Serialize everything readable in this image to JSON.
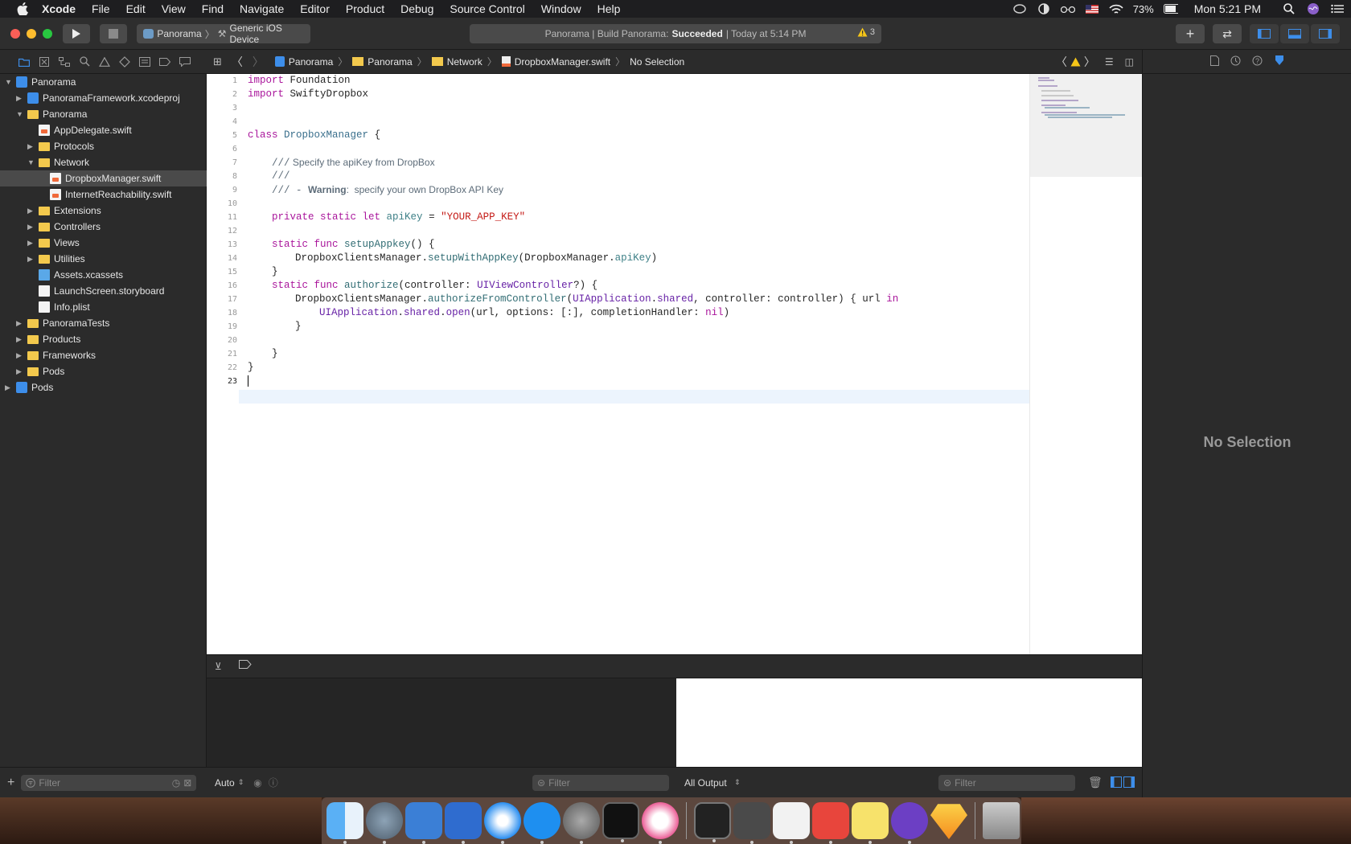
{
  "menubar": {
    "app_name": "Xcode",
    "items": [
      "File",
      "Edit",
      "View",
      "Find",
      "Navigate",
      "Editor",
      "Product",
      "Debug",
      "Source Control",
      "Window",
      "Help"
    ],
    "battery": "73%",
    "clock": "Mon 5:21 PM"
  },
  "toolbar": {
    "scheme": "Panorama",
    "destination": "Generic iOS Device",
    "activity_prefix": "Panorama | Build Panorama:",
    "activity_status": "Succeeded",
    "activity_time": "| Today at 5:14 PM",
    "warning_count": "3"
  },
  "navigator": {
    "rows": [
      {
        "label": "Panorama",
        "indent": 0,
        "disclosure": "open",
        "icon": "project-icon"
      },
      {
        "label": "PanoramaFramework.xcodeproj",
        "indent": 1,
        "disclosure": "closed",
        "icon": "project-icon"
      },
      {
        "label": "Panorama",
        "indent": 1,
        "disclosure": "open",
        "icon": "folder-icon"
      },
      {
        "label": "AppDelegate.swift",
        "indent": 2,
        "disclosure": "none",
        "icon": "swift-file-icon"
      },
      {
        "label": "Protocols",
        "indent": 2,
        "disclosure": "closed",
        "icon": "folder-icon"
      },
      {
        "label": "Network",
        "indent": 2,
        "disclosure": "open",
        "icon": "folder-icon"
      },
      {
        "label": "DropboxManager.swift",
        "indent": 3,
        "disclosure": "none",
        "icon": "swift-file-icon",
        "selected": true
      },
      {
        "label": "InternetReachability.swift",
        "indent": 3,
        "disclosure": "none",
        "icon": "swift-file-icon"
      },
      {
        "label": "Extensions",
        "indent": 2,
        "disclosure": "closed",
        "icon": "folder-icon"
      },
      {
        "label": "Controllers",
        "indent": 2,
        "disclosure": "closed",
        "icon": "folder-icon"
      },
      {
        "label": "Views",
        "indent": 2,
        "disclosure": "closed",
        "icon": "folder-icon"
      },
      {
        "label": "Utilities",
        "indent": 2,
        "disclosure": "closed",
        "icon": "folder-icon"
      },
      {
        "label": "Assets.xcassets",
        "indent": 2,
        "disclosure": "none",
        "icon": "assets-icon"
      },
      {
        "label": "LaunchScreen.storyboard",
        "indent": 2,
        "disclosure": "none",
        "icon": "storyboard-icon"
      },
      {
        "label": "Info.plist",
        "indent": 2,
        "disclosure": "none",
        "icon": "plist-icon"
      },
      {
        "label": "PanoramaTests",
        "indent": 1,
        "disclosure": "closed",
        "icon": "folder-icon"
      },
      {
        "label": "Products",
        "indent": 1,
        "disclosure": "closed",
        "icon": "folder-icon"
      },
      {
        "label": "Frameworks",
        "indent": 1,
        "disclosure": "closed",
        "icon": "folder-icon"
      },
      {
        "label": "Pods",
        "indent": 1,
        "disclosure": "closed",
        "icon": "folder-icon"
      },
      {
        "label": "Pods",
        "indent": 0,
        "disclosure": "closed",
        "icon": "project-icon"
      }
    ],
    "filter_placeholder": "Filter"
  },
  "jumpbar": {
    "crumbs": [
      "Panorama",
      "Panorama",
      "Network",
      "DropboxManager.swift",
      "No Selection"
    ]
  },
  "editor": {
    "line_numbers": [
      "1",
      "2",
      "3",
      "4",
      "5",
      "6",
      "7",
      "8",
      "9",
      "10",
      "11",
      "12",
      "13",
      "14",
      "15",
      "16",
      "17",
      "18",
      "19",
      "20",
      "21",
      "22",
      "23"
    ],
    "current_line": "23",
    "code": {
      "l1_kw": "import",
      "l1_rest": " Foundation",
      "l2_kw": "import",
      "l2_rest": " SwiftyDropbox",
      "l5_kw": "class",
      "l5_type": "DropboxManager",
      "l5_rest": " {",
      "l7_mark": "///",
      "l7_text": " Specify the apiKey from DropBox",
      "l8_mark": "///",
      "l9_mark": "/// - ",
      "l9_bold": "Warning",
      "l9_text": ":  specify your own DropBox API Key",
      "l11_kw": "private static let",
      "l11_var": "apiKey",
      "l11_eq": " = ",
      "l11_str": "\"YOUR_APP_KEY\"",
      "l13_kw": "static func",
      "l13_fn": "setupAppkey",
      "l13_rest": "() {",
      "l14_type": "DropboxClientsManager",
      "l14_dot": ".",
      "l14_fn": "setupWithAppKey",
      "l14_p": "(",
      "l14_type2": "DropboxManager",
      "l14_dot2": ".",
      "l14_var": "apiKey",
      "l14_end": ")",
      "l15": "}",
      "l16_kw": "static func",
      "l16_fn": "authorize",
      "l16_a": "(controller: ",
      "l16_type": "UIViewController",
      "l16_b": "?) {",
      "l17_type": "DropboxClientsManager",
      "l17_dot": ".",
      "l17_fn": "authorizeFromController",
      "l17_p": "(",
      "l17_type2": "UIApplication",
      "l17_dot2": ".",
      "l17_var": "shared",
      "l17_rest": ", controller: controller) { url ",
      "l17_kw": "in",
      "l18_type": "UIApplication",
      "l18_dot": ".",
      "l18_var": "shared",
      "l18_dot2": ".",
      "l18_fn": "open",
      "l18_rest": "(url, options: [:], completionHandler: ",
      "l18_kw": "nil",
      "l18_end": ")",
      "l19": "}",
      "l21": "}",
      "l22": "}"
    }
  },
  "debug": {
    "auto_label": "Auto",
    "filter_placeholder": "Filter",
    "output_label": "All Output",
    "console_filter_placeholder": "Filter"
  },
  "inspector": {
    "empty_label": "No Selection"
  },
  "colors": {
    "keyword": "#a9159b",
    "type": "#3a6f8c",
    "string": "#c41a16",
    "comment": "#5d6c79",
    "accent": "#3d8eea"
  }
}
